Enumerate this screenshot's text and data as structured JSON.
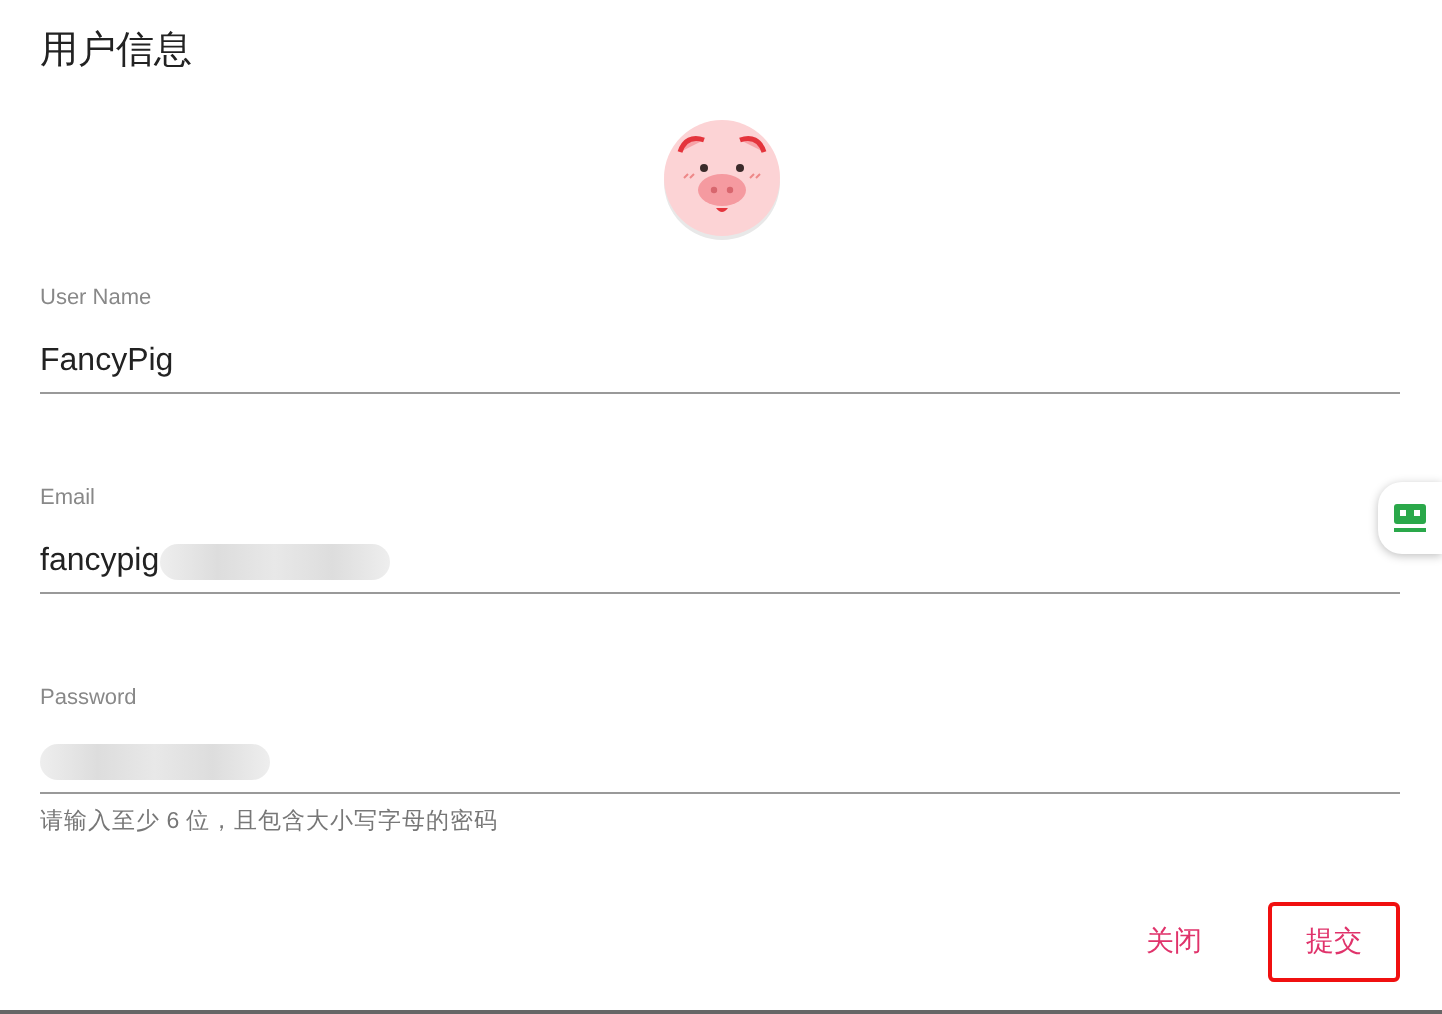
{
  "dialog": {
    "title": "用户信息"
  },
  "fields": [
    {
      "label": "User Name",
      "value": "FancyPig",
      "redacted": false
    },
    {
      "label": "Email",
      "value": "fancypig",
      "redacted": true
    },
    {
      "label": "Password",
      "redacted": true,
      "helper": "请输入至少 6 位，且包含大小写字母的密码"
    }
  ],
  "buttons": [
    {
      "label": "关闭",
      "highlighted": false
    },
    {
      "label": "提交",
      "highlighted": true
    }
  ]
}
